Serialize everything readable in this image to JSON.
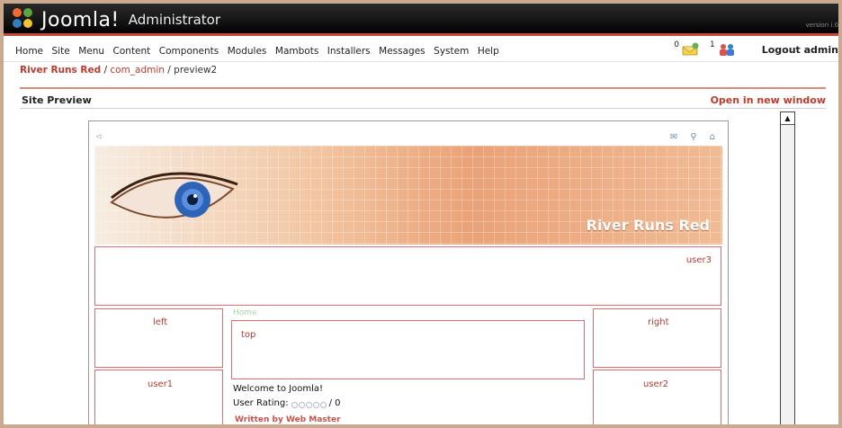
{
  "header": {
    "brand": "Joomla!",
    "subtitle": "Administrator",
    "version_tag": "version i.0"
  },
  "menu": {
    "items": [
      "Home",
      "Site",
      "Menu",
      "Content",
      "Components",
      "Modules",
      "Mambots",
      "Installers",
      "Messages",
      "System",
      "Help"
    ],
    "messages_count": "0",
    "users_count": "1",
    "logout_label": "Logout admin"
  },
  "breadcrumb": {
    "site": "River Runs Red",
    "sep1": " / ",
    "component": "com_admin",
    "sep2": " / ",
    "current": "preview2"
  },
  "section": {
    "title": "Site Preview",
    "open_new_window": "Open in new window"
  },
  "preview": {
    "banner_title": "River Runs Red",
    "modules": {
      "user3": "user3",
      "left": "left",
      "top": "top",
      "right": "right",
      "user1": "user1",
      "user2": "user2"
    },
    "home_link": "Home",
    "welcome": "Welcome to Joomla!",
    "rating_label": "User Rating:",
    "rating_value": "/ 0",
    "author": "Written by Web Master"
  },
  "colors": {
    "accent_red": "#c0392b",
    "module_border": "#e46b6b",
    "header_bg": "#141414"
  }
}
